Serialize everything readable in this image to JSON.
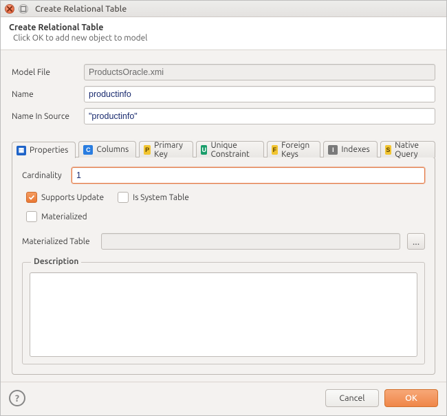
{
  "window": {
    "title": "Create Relational Table"
  },
  "header": {
    "title": "Create Relational Table",
    "subtitle": "Click OK to add new object to model"
  },
  "fields": {
    "model_file": {
      "label": "Model File",
      "value": "ProductsOracle.xmi"
    },
    "name": {
      "label": "Name",
      "value": "productinfo"
    },
    "name_in_source": {
      "label": "Name In Source",
      "value": "\"productinfo\""
    }
  },
  "tabs": [
    {
      "label": "Properties"
    },
    {
      "label": "Columns"
    },
    {
      "label": "Primary Key"
    },
    {
      "label": "Unique Constraint"
    },
    {
      "label": "Foreign Keys"
    },
    {
      "label": "Indexes"
    },
    {
      "label": "Native Query"
    }
  ],
  "properties": {
    "cardinality": {
      "label": "Cardinality",
      "value": "1"
    },
    "supports_update": {
      "label": "Supports Update",
      "checked": true
    },
    "is_system_table": {
      "label": "Is System Table",
      "checked": false
    },
    "materialized": {
      "label": "Materialized",
      "checked": false
    },
    "materialized_table": {
      "label": "Materialized Table",
      "value": ""
    },
    "browse_label": "...",
    "description": {
      "label": "Description",
      "value": ""
    }
  },
  "footer": {
    "cancel": "Cancel",
    "ok": "OK"
  }
}
